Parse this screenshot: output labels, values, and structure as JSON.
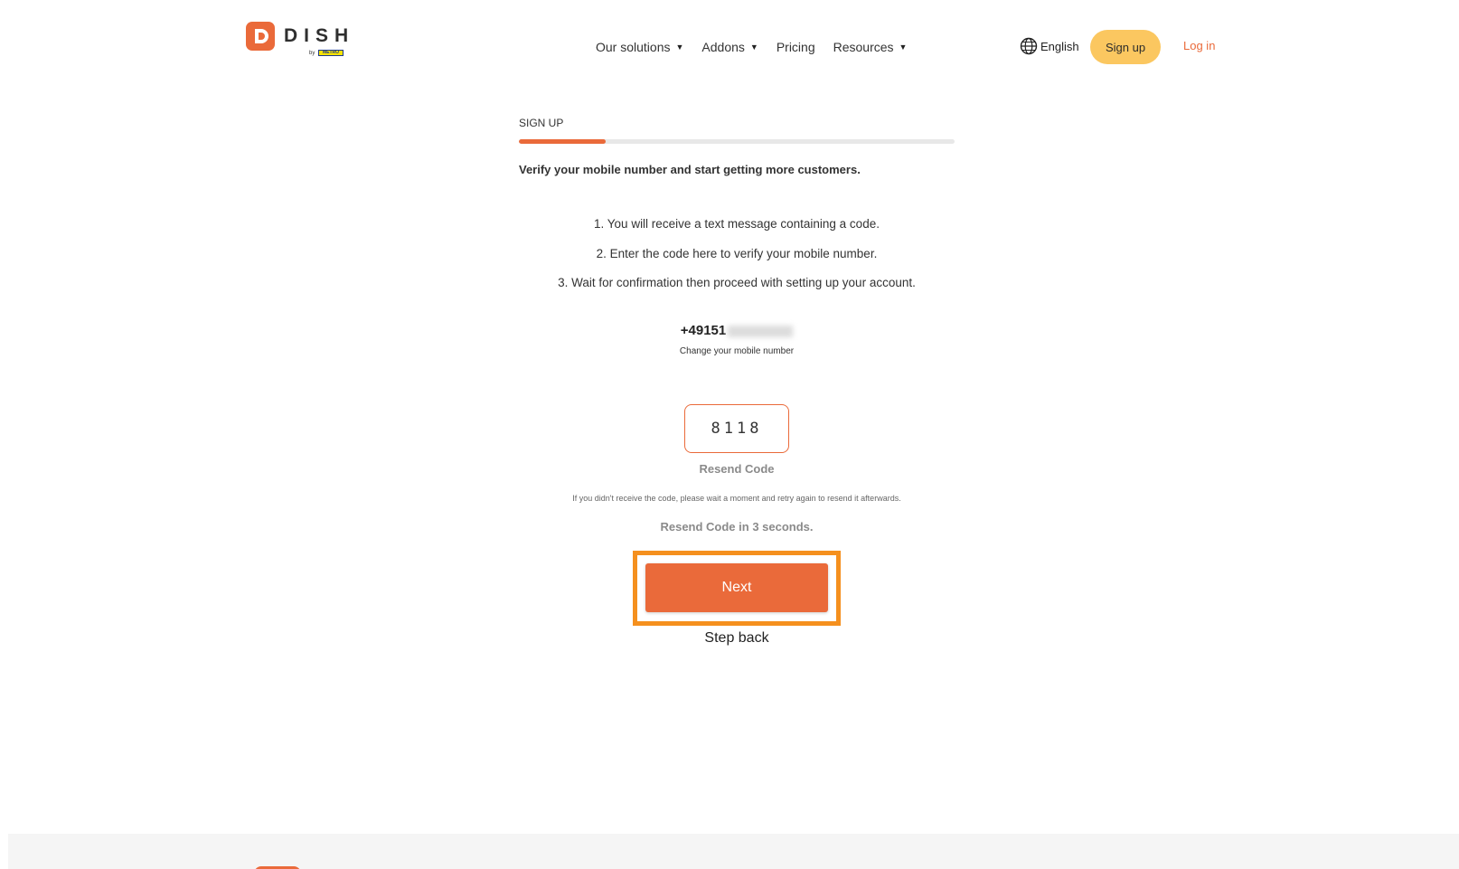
{
  "header": {
    "logo": {
      "wordmark": "DISH",
      "by": "by",
      "brand": "METRO"
    },
    "nav": [
      {
        "label": "Our solutions",
        "has_dropdown": true
      },
      {
        "label": "Addons",
        "has_dropdown": true
      },
      {
        "label": "Pricing",
        "has_dropdown": false
      },
      {
        "label": "Resources",
        "has_dropdown": true
      }
    ],
    "language": "English",
    "signup_label": "Sign up",
    "login_label": "Log in"
  },
  "signup": {
    "step_label": "SIGN UP",
    "progress": 0.2,
    "headline": "Verify your mobile number and start getting more customers.",
    "steps": [
      "1. You will receive a text message containing a code.",
      "2. Enter the code here to verify your mobile number.",
      "3. Wait for confirmation then proceed with setting up your account."
    ],
    "phone_prefix": "+49151",
    "change_number_label": "Change your mobile number",
    "code_value": "8118",
    "resend_label": "Resend Code",
    "resend_note": "If you didn't receive the code, please wait a moment and retry again to resend it afterwards.",
    "countdown": "Resend Code in 3 seconds.",
    "next_label": "Next",
    "step_back_label": "Step back"
  },
  "colors": {
    "accent": "#ea6a3a",
    "signup_button": "#fbc760",
    "highlight": "#f5901e"
  }
}
